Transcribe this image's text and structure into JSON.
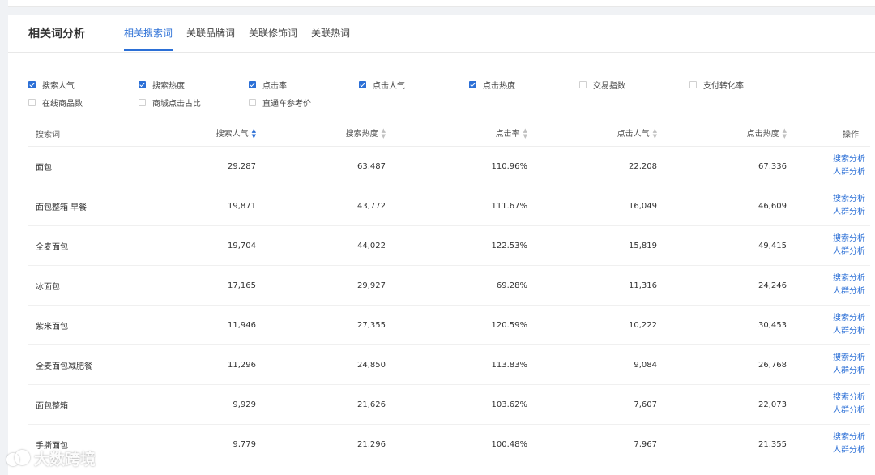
{
  "panel": {
    "title": "相关词分析",
    "tabs": [
      {
        "label": "相关搜索词",
        "active": true
      },
      {
        "label": "关联品牌词",
        "active": false
      },
      {
        "label": "关联修饰词",
        "active": false
      },
      {
        "label": "关联热词",
        "active": false
      }
    ]
  },
  "filters": {
    "row1": [
      {
        "label": "搜索人气",
        "checked": true
      },
      {
        "label": "搜索热度",
        "checked": true
      },
      {
        "label": "点击率",
        "checked": true
      },
      {
        "label": "点击人气",
        "checked": true
      },
      {
        "label": "点击热度",
        "checked": true
      },
      {
        "label": "交易指数",
        "checked": false
      },
      {
        "label": "支付转化率",
        "checked": false
      }
    ],
    "row2": [
      {
        "label": "在线商品数",
        "checked": false
      },
      {
        "label": "商城点击占比",
        "checked": false
      },
      {
        "label": "直通车参考价",
        "checked": false
      }
    ]
  },
  "table": {
    "headers": {
      "keyword": "搜索词",
      "search_popularity": "搜索人气",
      "search_heat": "搜索热度",
      "ctr": "点击率",
      "click_popularity": "点击人气",
      "click_heat": "点击热度",
      "action": "操作"
    },
    "action_labels": {
      "search_analysis": "搜索分析",
      "crowd_analysis": "人群分析"
    },
    "rows": [
      {
        "keyword": "面包",
        "search_popularity": "29,287",
        "search_heat": "63,487",
        "ctr": "110.96%",
        "click_popularity": "22,208",
        "click_heat": "67,336"
      },
      {
        "keyword": "面包整箱 早餐",
        "search_popularity": "19,871",
        "search_heat": "43,772",
        "ctr": "111.67%",
        "click_popularity": "16,049",
        "click_heat": "46,609"
      },
      {
        "keyword": "全麦面包",
        "search_popularity": "19,704",
        "search_heat": "44,022",
        "ctr": "122.53%",
        "click_popularity": "15,819",
        "click_heat": "49,415"
      },
      {
        "keyword": "冰面包",
        "search_popularity": "17,165",
        "search_heat": "29,927",
        "ctr": "69.28%",
        "click_popularity": "11,316",
        "click_heat": "24,246"
      },
      {
        "keyword": "紫米面包",
        "search_popularity": "11,946",
        "search_heat": "27,355",
        "ctr": "120.59%",
        "click_popularity": "10,222",
        "click_heat": "30,453"
      },
      {
        "keyword": "全麦面包减肥餐",
        "search_popularity": "11,296",
        "search_heat": "24,850",
        "ctr": "113.83%",
        "click_popularity": "9,084",
        "click_heat": "26,768"
      },
      {
        "keyword": "面包整箱",
        "search_popularity": "9,929",
        "search_heat": "21,626",
        "ctr": "103.62%",
        "click_popularity": "7,607",
        "click_heat": "22,073"
      },
      {
        "keyword": "手撕面包",
        "search_popularity": "9,779",
        "search_heat": "21,296",
        "ctr": "100.48%",
        "click_popularity": "7,967",
        "click_heat": "21,355"
      }
    ]
  },
  "watermark": {
    "text": "大数跨境"
  },
  "colors": {
    "accent": "#2b6fd6",
    "background": "#f0f2f5"
  }
}
